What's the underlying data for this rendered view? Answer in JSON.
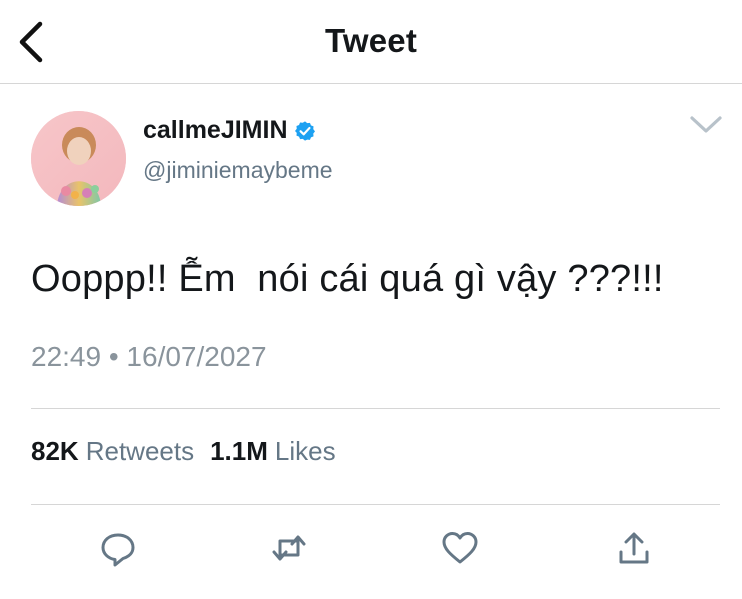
{
  "header": {
    "title": "Tweet"
  },
  "tweet": {
    "display_name": "callmeJIMIN",
    "handle": "@jiminiemaybeme",
    "text": "Ooppp!! Ễm  nói cái quá gì vậy ???!!!",
    "timestamp": "22:49 • 16/07/2027"
  },
  "stats": {
    "retweets_count": "82K",
    "retweets_label": "Retweets",
    "likes_count": "1.1M",
    "likes_label": "Likes"
  },
  "icons": {
    "back": "chevron-left-icon",
    "verified": "verified-badge-icon",
    "more": "chevron-down-icon",
    "reply": "reply-icon",
    "retweet": "retweet-icon",
    "like": "heart-icon",
    "share": "share-icon"
  },
  "colors": {
    "verified": "#1da1f2",
    "action_icon": "#657786",
    "secondary_text": "#657786",
    "divider": "#d6d6d6"
  }
}
